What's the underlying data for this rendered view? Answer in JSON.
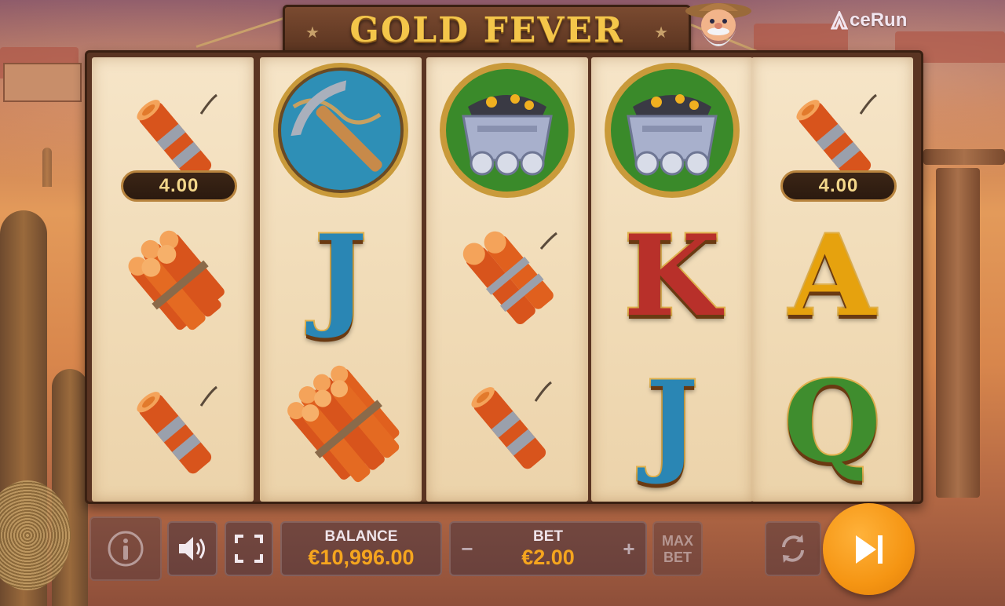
{
  "game": {
    "title": "GOLD FEVER",
    "provider_logo": "ceRun"
  },
  "reels": [
    {
      "symbols": [
        "dynamite-single",
        "dynamite-bundle",
        "dynamite-single"
      ],
      "value_tag": "4.00"
    },
    {
      "symbols": [
        "pickaxe",
        "J",
        "dynamite-big-bundle"
      ]
    },
    {
      "symbols": [
        "mine-cart",
        "dynamite-pair",
        "dynamite-single"
      ]
    },
    {
      "symbols": [
        "mine-cart",
        "K",
        "J"
      ]
    },
    {
      "symbols": [
        "dynamite-single",
        "A",
        "Q"
      ],
      "value_tag": "4.00"
    }
  ],
  "controls": {
    "balance_label": "BALANCE",
    "balance_value": "€10,996.00",
    "bet_label": "BET",
    "bet_value": "€2.00",
    "minus": "−",
    "plus": "+",
    "max_bet_line1": "MAX",
    "max_bet_line2": "BET",
    "icons": {
      "info": "info-icon",
      "sound": "speaker-icon",
      "fullscreen": "fullscreen-icon",
      "autoplay": "autoplay-icon",
      "spin": "play-skip-icon"
    }
  },
  "colors": {
    "accent": "#f59513",
    "value_text": "#f3d78a",
    "title_gold": "#f4c64a",
    "J": "#2a86b4",
    "K": "#b8302a",
    "A": "#e6a20e",
    "Q": "#3f8d2e"
  }
}
